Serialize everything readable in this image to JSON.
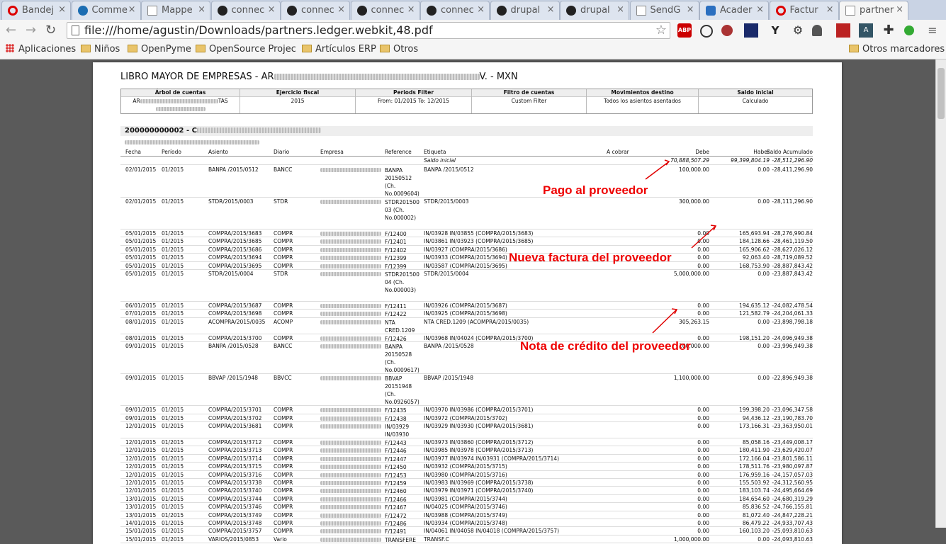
{
  "browser": {
    "tabs": [
      {
        "label": "Bandej",
        "icon": "opera-icon"
      },
      {
        "label": "Comme",
        "icon": "drupal-icon"
      },
      {
        "label": "Mappe",
        "icon": "document-icon"
      },
      {
        "label": "connec",
        "icon": "github-icon"
      },
      {
        "label": "connec",
        "icon": "github-icon"
      },
      {
        "label": "connec",
        "icon": "github-icon"
      },
      {
        "label": "connec",
        "icon": "github-icon"
      },
      {
        "label": "drupal",
        "icon": "github-icon"
      },
      {
        "label": "drupal",
        "icon": "github-icon"
      },
      {
        "label": "SendG",
        "icon": "document-icon"
      },
      {
        "label": "Acader",
        "icon": "academia-icon"
      },
      {
        "label": "Factur",
        "icon": "opera-icon"
      },
      {
        "label": "partner",
        "icon": "document-icon"
      }
    ],
    "url": "file:///home/agustin/Downloads/partners.ledger.webkit,48.pdf",
    "bookmarks": [
      "Aplicaciones",
      "Niños",
      "OpenPyme",
      "OpenSource Projec",
      "Artículos ERP",
      "Otros"
    ],
    "other_bookmarks": "Otros marcadores",
    "extensions": {
      "abp": "ABP",
      "y": "Y"
    }
  },
  "report": {
    "title_prefix": "LIBRO MAYOR DE EMPRESAS - AR",
    "title_suffix": "V. - MXN",
    "filters": [
      {
        "header": "Árbol de cuentas",
        "value": "AR",
        "value2": "TAS"
      },
      {
        "header": "Ejercicio fiscal",
        "value": "2015"
      },
      {
        "header": "Periods Filter",
        "value": "From: 01/2015 To: 12/2015"
      },
      {
        "header": "Filtro de cuentas",
        "value": "Custom Filter"
      },
      {
        "header": "Movimientos destino",
        "value": "Todos los asientos asentados"
      },
      {
        "header": "Saldo inicial",
        "value": "Calculado"
      }
    ],
    "partner_code": "200000000002 - C",
    "columns": [
      "Fecha",
      "Período",
      "Asiento",
      "Diario",
      "Empresa",
      "Reference",
      "Etiqueta",
      "A cobrar",
      "Debe",
      "Haber",
      "Saldo Acumulado"
    ],
    "initial_label": "Saldo inicial",
    "initial_debe": "70,888,507.29",
    "initial_haber": "99,399,804.19",
    "initial_saldo": "-28,511,296.90",
    "rows": [
      {
        "fecha": "02/01/2015",
        "periodo": "01/2015",
        "asiento": "BANPA /2015/0512",
        "diario": "BANCC",
        "ref": "BANPA 20150512 (Ch. No.0009604)",
        "etiqueta": "BANPA /2015/0512",
        "debe": "100,000.00",
        "haber": "0.00",
        "saldo": "-28,411,296.90"
      },
      {
        "fecha": "02/01/2015",
        "periodo": "01/2015",
        "asiento": "STDR/2015/0003",
        "diario": "STDR",
        "ref": "STDR201500 03 (Ch. No.000002)",
        "etiqueta": "STDR/2015/0003",
        "debe": "300,000.00",
        "haber": "0.00",
        "saldo": "-28,111,296.90"
      },
      {
        "fecha": "05/01/2015",
        "periodo": "01/2015",
        "asiento": "COMPRA/2015/3683",
        "diario": "COMPR",
        "ref": "F/12400",
        "etiqueta": "IN/03928 IN/03855 (COMPRA/2015/3683)",
        "debe": "0.00",
        "haber": "165,693.94",
        "saldo": "-28,276,990.84"
      },
      {
        "fecha": "05/01/2015",
        "periodo": "01/2015",
        "asiento": "COMPRA/2015/3685",
        "diario": "COMPR",
        "ref": "F/12401",
        "etiqueta": "IN/03861 IN/03923 (COMPRA/2015/3685)",
        "debe": "0.00",
        "haber": "184,128.66",
        "saldo": "-28,461,119.50"
      },
      {
        "fecha": "05/01/2015",
        "periodo": "01/2015",
        "asiento": "COMPRA/2015/3686",
        "diario": "COMPR",
        "ref": "F/12402",
        "etiqueta": "IN/03927 (COMPRA/2015/3686)",
        "debe": "0.00",
        "haber": "165,906.62",
        "saldo": "-28,627,026.12"
      },
      {
        "fecha": "05/01/2015",
        "periodo": "01/2015",
        "asiento": "COMPRA/2015/3694",
        "diario": "COMPR",
        "ref": "F/12399",
        "etiqueta": "IN/03933 (COMPRA/2015/3694)",
        "debe": "0.00",
        "haber": "92,063.40",
        "saldo": "-28,719,089.52"
      },
      {
        "fecha": "05/01/2015",
        "periodo": "01/2015",
        "asiento": "COMPRA/2015/3695",
        "diario": "COMPR",
        "ref": "F/12399",
        "etiqueta": "IN/03587 (COMPRA/2015/3695)",
        "debe": "0.00",
        "haber": "168,753.90",
        "saldo": "-28,887,843.42"
      },
      {
        "fecha": "05/01/2015",
        "periodo": "01/2015",
        "asiento": "STDR/2015/0004",
        "diario": "STDR",
        "ref": "STDR201500 04 (Ch. No.000003)",
        "etiqueta": "STDR/2015/0004",
        "debe": "5,000,000.00",
        "haber": "0.00",
        "saldo": "-23,887,843.42"
      },
      {
        "fecha": "06/01/2015",
        "periodo": "01/2015",
        "asiento": "COMPRA/2015/3687",
        "diario": "COMPR",
        "ref": "F/12411",
        "etiqueta": "IN/03926 (COMPRA/2015/3687)",
        "debe": "0.00",
        "haber": "194,635.12",
        "saldo": "-24,082,478.54"
      },
      {
        "fecha": "07/01/2015",
        "periodo": "01/2015",
        "asiento": "COMPRA/2015/3698",
        "diario": "COMPR",
        "ref": "F/12422",
        "etiqueta": "IN/03925 (COMPRA/2015/3698)",
        "debe": "0.00",
        "haber": "121,582.79",
        "saldo": "-24,204,061.33"
      },
      {
        "fecha": "08/01/2015",
        "periodo": "01/2015",
        "asiento": "ACOMPRA/2015/0035",
        "diario": "ACOMP",
        "ref": "NTA CRED.1209",
        "etiqueta": "NTA CRED.1209 (ACOMPRA/2015/0035)",
        "debe": "305,263.15",
        "haber": "0.00",
        "saldo": "-23,898,798.18"
      },
      {
        "fecha": "08/01/2015",
        "periodo": "01/2015",
        "asiento": "COMPRA/2015/3700",
        "diario": "COMPR",
        "ref": "F/12426",
        "etiqueta": "IN/03968 IN/04024 (COMPRA/2015/3700)",
        "debe": "0.00",
        "haber": "198,151.20",
        "saldo": "-24,096,949.38"
      },
      {
        "fecha": "09/01/2015",
        "periodo": "01/2015",
        "asiento": "BANPA /2015/0528",
        "diario": "BANCC",
        "ref": "BANPA 20150528 (Ch. No.0009617)",
        "etiqueta": "BANPA /2015/0528",
        "debe": "100,000.00",
        "haber": "0.00",
        "saldo": "-23,996,949.38"
      },
      {
        "fecha": "09/01/2015",
        "periodo": "01/2015",
        "asiento": "BBVAP /2015/1948",
        "diario": "BBVCC",
        "ref": "BBVAP 20151948 (Ch. No.0926057)",
        "etiqueta": "BBVAP /2015/1948",
        "debe": "1,100,000.00",
        "haber": "0.00",
        "saldo": "-22,896,949.38"
      },
      {
        "fecha": "09/01/2015",
        "periodo": "01/2015",
        "asiento": "COMPRA/2015/3701",
        "diario": "COMPR",
        "ref": "F/12435",
        "etiqueta": "IN/03970 IN/03986 (COMPRA/2015/3701)",
        "debe": "0.00",
        "haber": "199,398.20",
        "saldo": "-23,096,347.58"
      },
      {
        "fecha": "09/01/2015",
        "periodo": "01/2015",
        "asiento": "COMPRA/2015/3702",
        "diario": "COMPR",
        "ref": "F/12438",
        "etiqueta": "IN/03972 (COMPRA/2015/3702)",
        "debe": "0.00",
        "haber": "94,436.12",
        "saldo": "-23,190,783.70"
      },
      {
        "fecha": "12/01/2015",
        "periodo": "01/2015",
        "asiento": "COMPRA/2015/3681",
        "diario": "COMPR",
        "ref": "IN/03929 IN/03930",
        "etiqueta": "IN/03929 IN/03930 (COMPRA/2015/3681)",
        "debe": "0.00",
        "haber": "173,166.31",
        "saldo": "-23,363,950.01"
      },
      {
        "fecha": "12/01/2015",
        "periodo": "01/2015",
        "asiento": "COMPRA/2015/3712",
        "diario": "COMPR",
        "ref": "F/12443",
        "etiqueta": "IN/03973 IN/03860 (COMPRA/2015/3712)",
        "debe": "0.00",
        "haber": "85,058.16",
        "saldo": "-23,449,008.17"
      },
      {
        "fecha": "12/01/2015",
        "periodo": "01/2015",
        "asiento": "COMPRA/2015/3713",
        "diario": "COMPR",
        "ref": "F/12446",
        "etiqueta": "IN/03985 IN/03978 (COMPRA/2015/3713)",
        "debe": "0.00",
        "haber": "180,411.90",
        "saldo": "-23,629,420.07"
      },
      {
        "fecha": "12/01/2015",
        "periodo": "01/2015",
        "asiento": "COMPRA/2015/3714",
        "diario": "COMPR",
        "ref": "F/12447",
        "etiqueta": "IN/03977 IN/03974 IN/03931 (COMPRA/2015/3714)",
        "debe": "0.00",
        "haber": "172,166.04",
        "saldo": "-23,801,586.11"
      },
      {
        "fecha": "12/01/2015",
        "periodo": "01/2015",
        "asiento": "COMPRA/2015/3715",
        "diario": "COMPR",
        "ref": "F/12450",
        "etiqueta": "IN/03932 (COMPRA/2015/3715)",
        "debe": "0.00",
        "haber": "178,511.76",
        "saldo": "-23,980,097.87"
      },
      {
        "fecha": "12/01/2015",
        "periodo": "01/2015",
        "asiento": "COMPRA/2015/3716",
        "diario": "COMPR",
        "ref": "F/12453",
        "etiqueta": "IN/03980 (COMPRA/2015/3716)",
        "debe": "0.00",
        "haber": "176,959.16",
        "saldo": "-24,157,057.03"
      },
      {
        "fecha": "12/01/2015",
        "periodo": "01/2015",
        "asiento": "COMPRA/2015/3738",
        "diario": "COMPR",
        "ref": "F/12459",
        "etiqueta": "IN/03983 IN/03969 (COMPRA/2015/3738)",
        "debe": "0.00",
        "haber": "155,503.92",
        "saldo": "-24,312,560.95"
      },
      {
        "fecha": "12/01/2015",
        "periodo": "01/2015",
        "asiento": "COMPRA/2015/3740",
        "diario": "COMPR",
        "ref": "F/12460",
        "etiqueta": "IN/03979 IN/03971 (COMPRA/2015/3740)",
        "debe": "0.00",
        "haber": "183,103.74",
        "saldo": "-24,495,664.69"
      },
      {
        "fecha": "13/01/2015",
        "periodo": "01/2015",
        "asiento": "COMPRA/2015/3744",
        "diario": "COMPR",
        "ref": "F/12466",
        "etiqueta": "IN/03981 (COMPRA/2015/3744)",
        "debe": "0.00",
        "haber": "184,654.60",
        "saldo": "-24,680,319.29"
      },
      {
        "fecha": "13/01/2015",
        "periodo": "01/2015",
        "asiento": "COMPRA/2015/3746",
        "diario": "COMPR",
        "ref": "F/12467",
        "etiqueta": "IN/04025 (COMPRA/2015/3746)",
        "debe": "0.00",
        "haber": "85,836.52",
        "saldo": "-24,766,155.81"
      },
      {
        "fecha": "13/01/2015",
        "periodo": "01/2015",
        "asiento": "COMPRA/2015/3749",
        "diario": "COMPR",
        "ref": "F/12472",
        "etiqueta": "IN/03988 (COMPRA/2015/3749)",
        "debe": "0.00",
        "haber": "81,072.40",
        "saldo": "-24,847,228.21"
      },
      {
        "fecha": "14/01/2015",
        "periodo": "01/2015",
        "asiento": "COMPRA/2015/3748",
        "diario": "COMPR",
        "ref": "F/12486",
        "etiqueta": "IN/03934 (COMPRA/2015/3748)",
        "debe": "0.00",
        "haber": "86,479.22",
        "saldo": "-24,933,707.43"
      },
      {
        "fecha": "15/01/2015",
        "periodo": "01/2015",
        "asiento": "COMPRA/2015/3757",
        "diario": "COMPR",
        "ref": "F/12491",
        "etiqueta": "IN/04061 IN/04058 IN/04018 (COMPRA/2015/3757)",
        "debe": "0.00",
        "haber": "160,103.20",
        "saldo": "-25,093,810.63"
      },
      {
        "fecha": "15/01/2015",
        "periodo": "01/2015",
        "asiento": "VARIOS/2015/0853",
        "diario": "Vario",
        "ref": "TRANSFERE",
        "etiqueta": "TRANSF.C",
        "debe": "1,000,000.00",
        "haber": "0.00",
        "saldo": "-24,093,810.63"
      }
    ],
    "annotations": {
      "pago": "Pago al proveedor",
      "factura": "Nueva factura del proveedor",
      "nota": "Nota de crédito del proveedor"
    },
    "annotation_color": "#e00000"
  }
}
